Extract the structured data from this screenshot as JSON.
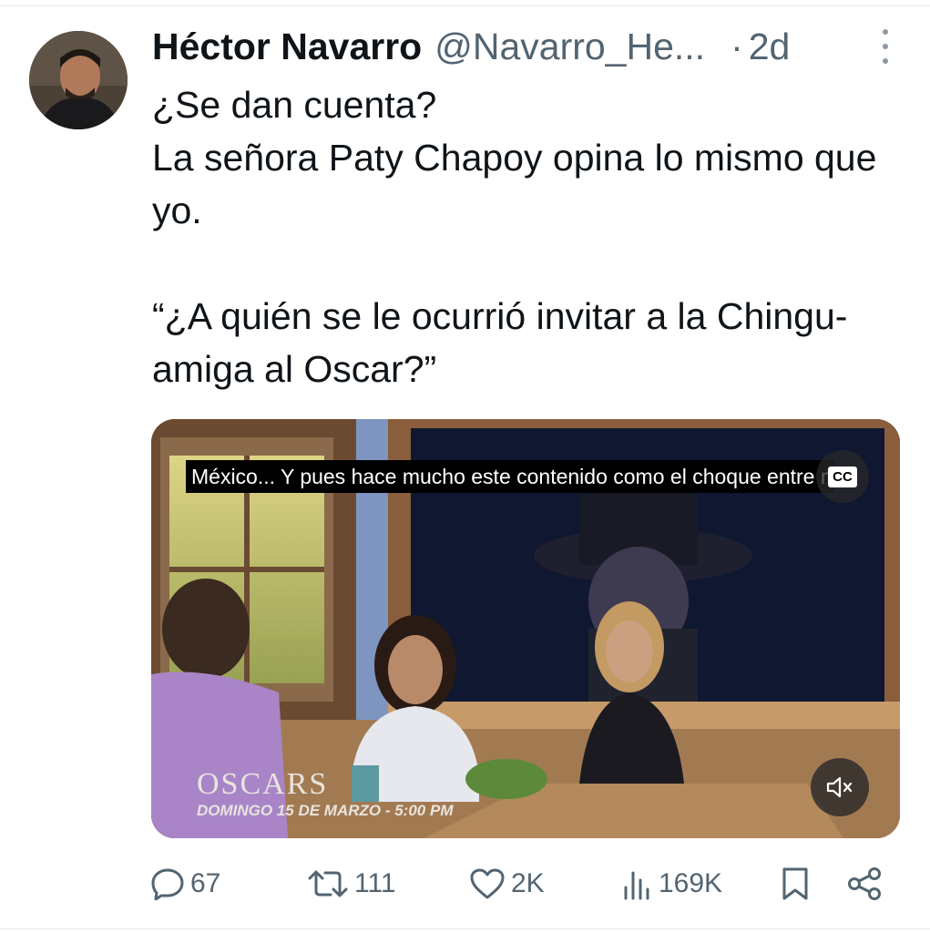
{
  "tweet": {
    "author": {
      "display_name": "Héctor Navarro",
      "handle": "@Navarro_He...",
      "time_separator": "·",
      "time": "2d"
    },
    "text_lines": [
      "¿Se dan cuenta?",
      "La señora Paty Chapoy opina lo mismo que yo.",
      "“¿A quién se le ocurrió invitar a la Chingu- amiga al Oscar?”"
    ],
    "media": {
      "type": "video",
      "caption": "México... Y pues hace mucho este contenido como el choque entre méx",
      "cc_label": "CC",
      "banner_brand": "OSCARS",
      "banner_date": "DOMINGO 15 DE MARZO - 5:00 PM"
    },
    "actions": {
      "replies": "67",
      "retweets": "111",
      "likes": "2K",
      "views": "169K"
    }
  },
  "icons": [
    "more-vertical-icon",
    "reply-icon",
    "retweet-icon",
    "like-icon",
    "views-icon",
    "bookmark-icon",
    "share-icon",
    "closed-caption-icon",
    "mute-icon"
  ],
  "colors": {
    "text": "#0f1419",
    "secondary": "#536471"
  }
}
